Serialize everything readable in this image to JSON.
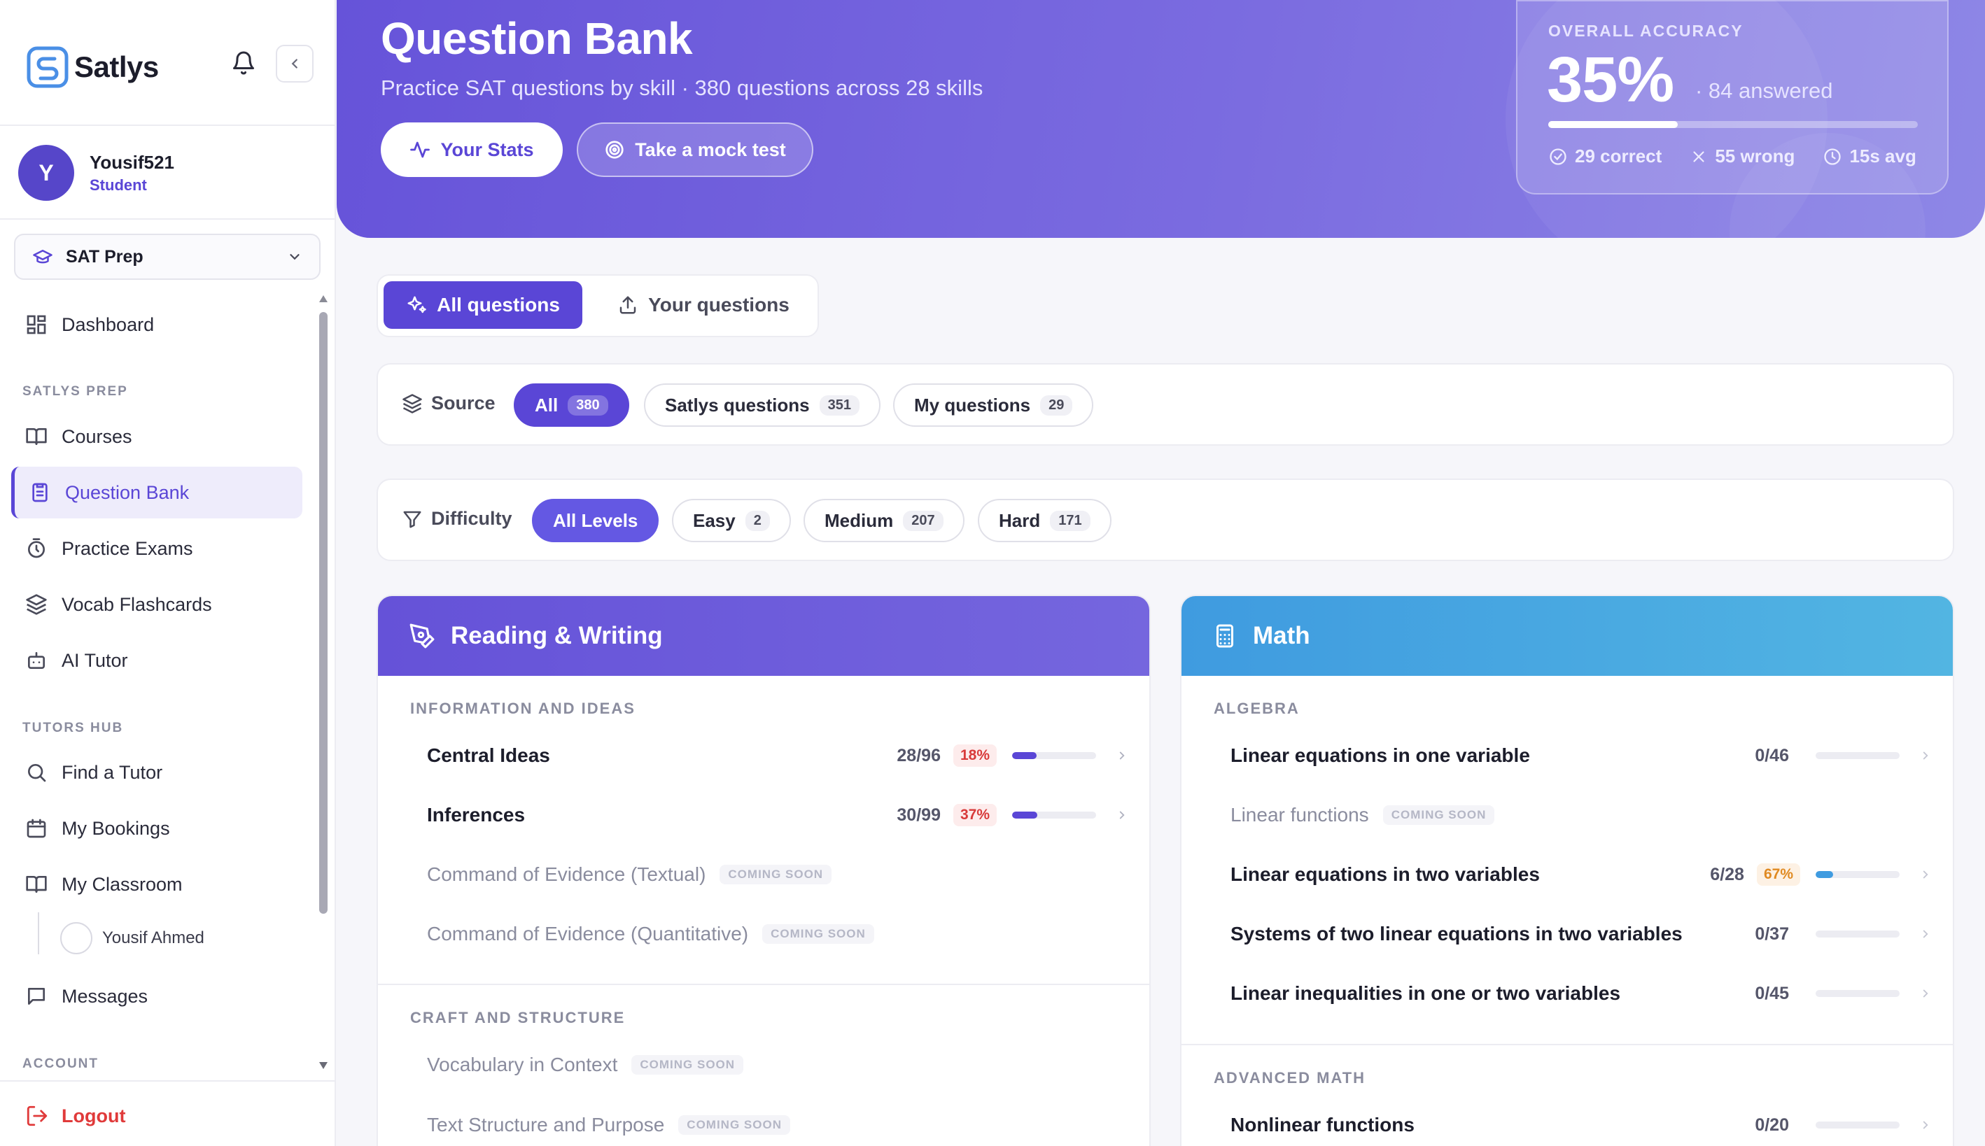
{
  "app": {
    "brand": "Satlys"
  },
  "user": {
    "initial": "Y",
    "name": "Yousif521",
    "role": "Student"
  },
  "course_select": {
    "label": "SAT Prep"
  },
  "nav": {
    "dashboard": "Dashboard",
    "section_prep": "SATLYS PREP",
    "courses": "Courses",
    "question_bank": "Question Bank",
    "practice_exams": "Practice Exams",
    "vocab": "Vocab Flashcards",
    "ai_tutor": "AI Tutor",
    "section_tutors": "TUTORS HUB",
    "find_tutor": "Find a Tutor",
    "bookings": "My Bookings",
    "classroom": "My Classroom",
    "classroom_member": "Yousif Ahmed",
    "messages": "Messages",
    "section_account": "ACCOUNT",
    "logout": "Logout"
  },
  "hero": {
    "title": "Question Bank",
    "subtitle": "Practice SAT questions by skill · 380 questions across 28 skills",
    "stats_button": "Your Stats",
    "mock_button": "Take a mock test"
  },
  "accuracy": {
    "label": "OVERALL ACCURACY",
    "value": "35%",
    "answered": "· 84 answered",
    "progress": 0.35,
    "correct": "29 correct",
    "wrong": "55 wrong",
    "avg": "15s avg"
  },
  "tabs": {
    "all": "All questions",
    "yours": "Your questions"
  },
  "source_filter": {
    "label": "Source",
    "options": [
      {
        "label": "All",
        "count": "380"
      },
      {
        "label": "Satlys questions",
        "count": "351"
      },
      {
        "label": "My questions",
        "count": "29"
      }
    ]
  },
  "difficulty_filter": {
    "label": "Difficulty",
    "options": [
      {
        "label": "All Levels",
        "count": ""
      },
      {
        "label": "Easy",
        "count": "2"
      },
      {
        "label": "Medium",
        "count": "207"
      },
      {
        "label": "Hard",
        "count": "171"
      }
    ]
  },
  "reading_writing": {
    "title": "Reading & Writing",
    "groups": [
      {
        "title": "INFORMATION AND IDEAS",
        "skills": [
          {
            "name": "Central Ideas",
            "progress": "28/96",
            "accuracy": "18%",
            "fill": 0.29
          },
          {
            "name": "Inferences",
            "progress": "30/99",
            "accuracy": "37%",
            "fill": 0.3
          },
          {
            "name": "Command of Evidence (Textual)",
            "tag": "COMING SOON"
          },
          {
            "name": "Command of Evidence (Quantitative)",
            "tag": "COMING SOON"
          }
        ]
      },
      {
        "title": "CRAFT AND STRUCTURE",
        "skills": [
          {
            "name": "Vocabulary in Context",
            "tag": "COMING SOON"
          },
          {
            "name": "Text Structure and Purpose",
            "tag": "COMING SOON"
          }
        ]
      }
    ]
  },
  "math": {
    "title": "Math",
    "groups": [
      {
        "title": "ALGEBRA",
        "skills": [
          {
            "name": "Linear equations in one variable",
            "progress": "0/46",
            "fill": 0
          },
          {
            "name": "Linear functions",
            "tag": "COMING SOON"
          },
          {
            "name": "Linear equations in two variables",
            "progress": "6/28",
            "accuracy": "67%",
            "fill": 0.21
          },
          {
            "name": "Systems of two linear equations in two variables",
            "progress": "0/37",
            "fill": 0
          },
          {
            "name": "Linear inequalities in one or two variables",
            "progress": "0/45",
            "fill": 0
          }
        ]
      },
      {
        "title": "ADVANCED MATH",
        "skills": [
          {
            "name": "Nonlinear functions",
            "progress": "0/20",
            "fill": 0
          }
        ]
      }
    ]
  },
  "colors": {
    "accent": "#5a46d6",
    "math": "#4aa8e2",
    "danger": "#d83a3a",
    "warning": "#e08a22"
  }
}
